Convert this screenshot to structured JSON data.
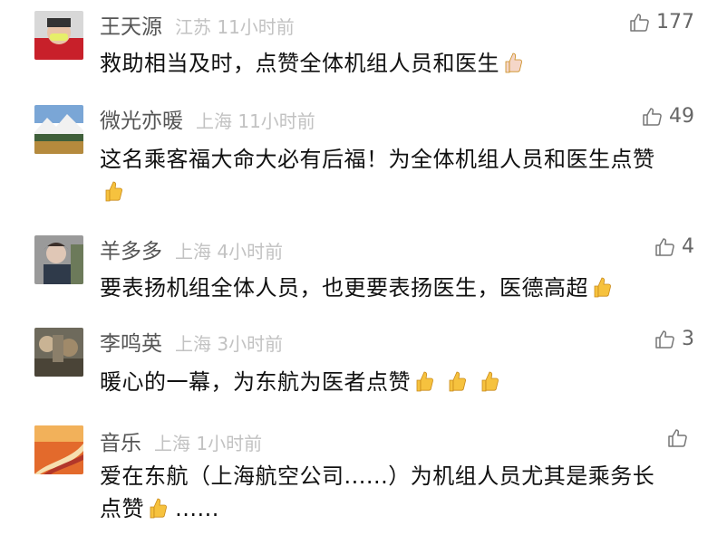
{
  "comments": [
    {
      "username": "王天源",
      "location": "江苏",
      "time": "11小时前",
      "likes": "177",
      "text": "救助相当及时，点赞全体机组人员和医生",
      "thumbs": 1,
      "thumb_color": "#f5d6c8",
      "suffix": ""
    },
    {
      "username": "微光亦暖",
      "location": "上海",
      "time": "11小时前",
      "likes": "49",
      "text": "这名乘客福大命大必有后福！为全体机组人员和医生点赞",
      "thumbs": 1,
      "thumb_color": "#f6c23e",
      "suffix": ""
    },
    {
      "username": "羊多多",
      "location": "上海",
      "time": "4小时前",
      "likes": "4",
      "text": "要表扬机组全体人员，也更要表扬医生，医德高超",
      "thumbs": 1,
      "thumb_color": "#f6c23e",
      "suffix": ""
    },
    {
      "username": "李鸣英",
      "location": "上海",
      "time": "3小时前",
      "likes": "3",
      "text": "暖心的一幕，为东航为医者点赞",
      "thumbs": 3,
      "thumb_color": "#f6c23e",
      "suffix": ""
    },
    {
      "username": "音乐",
      "location": "上海",
      "time": "1小时前",
      "likes": "",
      "text": "爱在东航（上海航空公司......）为机组人员尤其是乘务长点赞",
      "thumbs": 1,
      "thumb_color": "#f6c23e",
      "suffix": " ......"
    }
  ],
  "icons": {
    "like": "thumbs-up-outline-icon",
    "emoji": "thumbs-up-emoji-icon"
  }
}
